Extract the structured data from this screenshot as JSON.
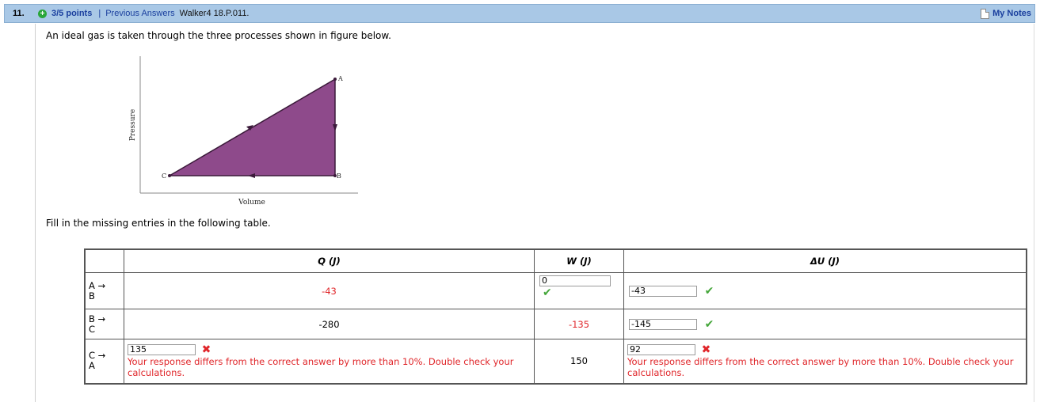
{
  "header": {
    "number": "11.",
    "points": "3/5 points",
    "separator": "|",
    "previous_answers": "Previous Answers",
    "code": "Walker4 18.P.011.",
    "my_notes": "My Notes"
  },
  "question": "An ideal gas is taken through the three processes shown in figure below.",
  "figure": {
    "y_label": "Pressure",
    "x_label": "Volume",
    "points": {
      "A": "A",
      "B": "B",
      "C": "C"
    },
    "fill_color": "#8e4a8b"
  },
  "instructions": "Fill in the missing entries in the following table.",
  "table": {
    "headers": {
      "q": "Q (J)",
      "w": "W (J)",
      "du": "ΔU (J)"
    },
    "rows": [
      {
        "label_top": "A →",
        "label_bottom": "B",
        "q_text": "-43",
        "w_input": "0",
        "w_status": "correct",
        "du_input": "-43",
        "du_status": "correct"
      },
      {
        "label_top": "B →",
        "label_bottom": "C",
        "q_text": "-280",
        "w_text": "-135",
        "du_input": "-145",
        "du_status": "correct"
      },
      {
        "label_top": "C →",
        "label_bottom": "A",
        "q_input": "135",
        "q_status": "incorrect",
        "q_message": "Your response differs from the correct answer by more than 10%. Double check your calculations.",
        "w_text": "150",
        "du_input": "92",
        "du_status": "incorrect",
        "du_message": "Your response differs from the correct answer by more than 10%. Double check your calculations."
      }
    ]
  },
  "colors": {
    "header_bg": "#a9c8e6",
    "link": "#1a3f9e",
    "error": "#e0262a",
    "success": "#44a63a"
  }
}
